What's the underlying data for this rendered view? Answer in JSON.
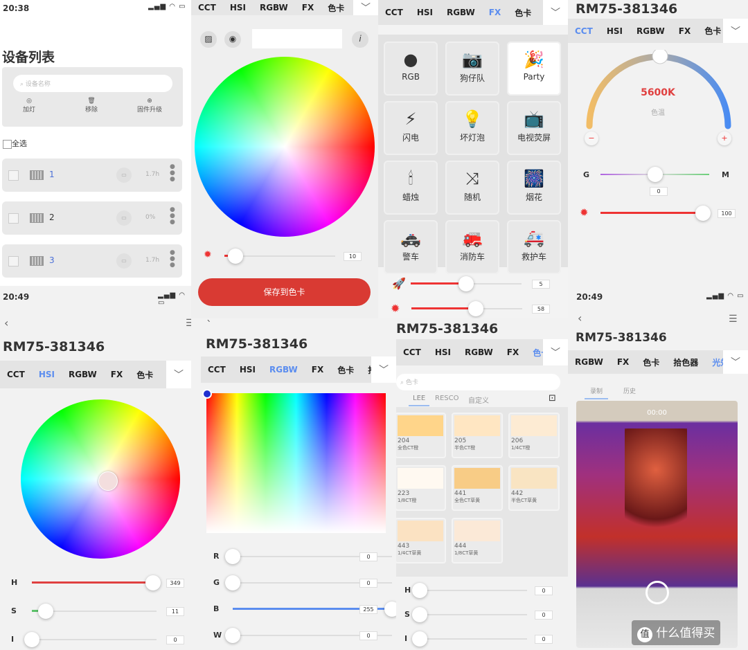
{
  "device_list": {
    "time": "20:38",
    "title": "设备列表",
    "search_placeholder": "设备名称",
    "actions": [
      "加灯",
      "移除",
      "固件升级"
    ],
    "select_all": "全选",
    "devices": [
      {
        "name": "1",
        "status": "1.7h"
      },
      {
        "name": "2",
        "status": "0%"
      },
      {
        "name": "3",
        "status": "1.7h"
      }
    ]
  },
  "tabs_main": [
    "CCT",
    "HSI",
    "RGBW",
    "FX",
    "色卡",
    "拾色器"
  ],
  "tabs_last": [
    "RGBW",
    "FX",
    "色卡",
    "拾色器",
    "光效拾取"
  ],
  "device_name": "RM75-381346",
  "picker": {
    "info": "i",
    "brightness": 10,
    "save_button": "保存到色卡",
    "active_tab": 5
  },
  "fx": {
    "active_tab": 3,
    "items": [
      {
        "label": "RGB",
        "icon": "rgb-icon",
        "glyph": "●"
      },
      {
        "label": "狗仔队",
        "icon": "camera-icon",
        "glyph": "📷"
      },
      {
        "label": "Party",
        "icon": "party-icon",
        "glyph": "🎉"
      },
      {
        "label": "闪电",
        "icon": "lightning-icon",
        "glyph": "⚡"
      },
      {
        "label": "坏灯泡",
        "icon": "bulb-icon",
        "glyph": "💡"
      },
      {
        "label": "电视荧屏",
        "icon": "tv-icon",
        "glyph": "📺"
      },
      {
        "label": "蜡烛",
        "icon": "candle-icon",
        "glyph": "🕯"
      },
      {
        "label": "随机",
        "icon": "shuffle-icon",
        "glyph": "⤨"
      },
      {
        "label": "烟花",
        "icon": "firework-icon",
        "glyph": "🎆"
      },
      {
        "label": "警车",
        "icon": "police-car-icon",
        "glyph": "🚓"
      },
      {
        "label": "消防车",
        "icon": "fire-truck-icon",
        "glyph": "🚒"
      },
      {
        "label": "救护车",
        "icon": "ambulance-icon",
        "glyph": "🚑"
      }
    ],
    "speed": 5,
    "brightness": 58,
    "active_item": "Party"
  },
  "cct": {
    "active_tab": 0,
    "value": "5600K",
    "label": "色温",
    "g_label": "G",
    "m_label": "M",
    "gm": 0,
    "brightness": 100
  },
  "hsi": {
    "time": "20:49",
    "active_tab": 1,
    "h": 349,
    "s": 11,
    "i": 0,
    "labels": [
      "H",
      "S",
      "I"
    ]
  },
  "rgbw": {
    "active_tab": 2,
    "labels": [
      "R",
      "G",
      "B",
      "W"
    ],
    "values": [
      0,
      0,
      255,
      0
    ]
  },
  "gel": {
    "active_tab": 4,
    "search_placeholder": "色卡",
    "sub_tabs": [
      "LEE",
      "RESCO",
      "自定义"
    ],
    "swatches": [
      {
        "code": "204",
        "name": "全色CT橙",
        "color": "#ffd58a"
      },
      {
        "code": "205",
        "name": "半色CT橙",
        "color": "#ffe6c2"
      },
      {
        "code": "206",
        "name": "1/4CT橙",
        "color": "#fdebd3"
      },
      {
        "code": "223",
        "name": "1/8CT橙",
        "color": "#fff9f1"
      },
      {
        "code": "441",
        "name": "全色CT草黄",
        "color": "#f8cc86"
      },
      {
        "code": "442",
        "name": "半色CT草黄",
        "color": "#f9e4c2"
      },
      {
        "code": "443",
        "name": "1/4CT草黄",
        "color": "#fbe2c2"
      },
      {
        "code": "444",
        "name": "1/8CT草黄",
        "color": "#fbe9d7"
      }
    ],
    "labels": [
      "H",
      "S",
      "I"
    ],
    "values": [
      0,
      0,
      0
    ]
  },
  "capture": {
    "time": "20:49",
    "active_tab": 4,
    "sub_tabs": [
      "录制",
      "历史"
    ],
    "timer": "00:00"
  },
  "watermark": "什么值得买"
}
